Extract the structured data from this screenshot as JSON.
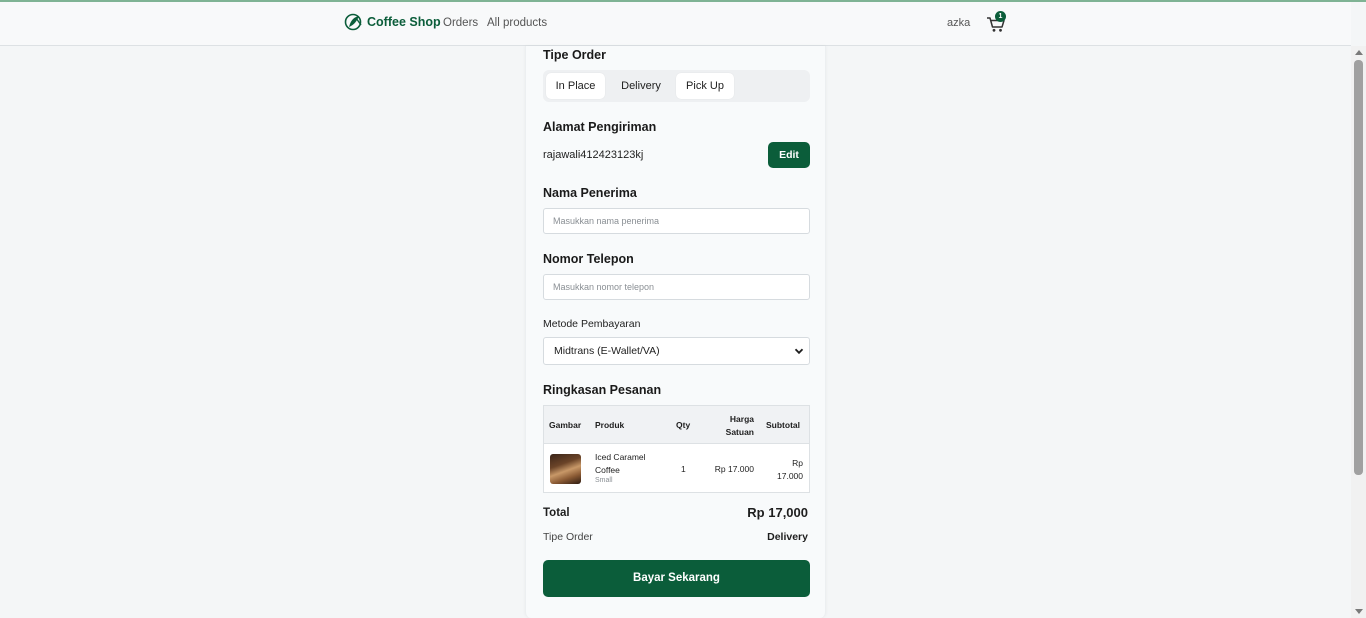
{
  "navbar": {
    "brand": "Coffee Shop",
    "links": [
      "Orders",
      "All products"
    ],
    "user": "azka",
    "cart_count": "1"
  },
  "order_type": {
    "title": "Tipe Order",
    "options": [
      "In Place",
      "Delivery",
      "Pick Up"
    ],
    "selected": "Delivery"
  },
  "address": {
    "title": "Alamat Pengiriman",
    "value": "rajawali412423123kj",
    "edit_label": "Edit"
  },
  "recipient": {
    "title": "Nama Penerima",
    "placeholder": "Masukkan nama penerima"
  },
  "phone": {
    "title": "Nomor Telepon",
    "placeholder": "Masukkan nomor telepon"
  },
  "payment": {
    "label": "Metode Pembayaran",
    "selected": "Midtrans (E-Wallet/VA)"
  },
  "summary": {
    "title": "Ringkasan Pesanan",
    "headers": [
      "Gambar",
      "Produk",
      "Qty",
      "Harga Satuan",
      "Subtotal"
    ],
    "rows": [
      {
        "product": "Iced Caramel Coffee",
        "size": "Small",
        "qty": "1",
        "price": "Rp 17.000",
        "subtotal": "Rp 17.000"
      }
    ]
  },
  "totals": {
    "total_label": "Total",
    "total_value": "Rp 17,000",
    "type_label": "Tipe Order",
    "type_value": "Delivery"
  },
  "pay_button": "Bayar Sekarang",
  "colors": {
    "brand_green": "#0b5d3a",
    "page_bg": "#f4f6f7"
  }
}
